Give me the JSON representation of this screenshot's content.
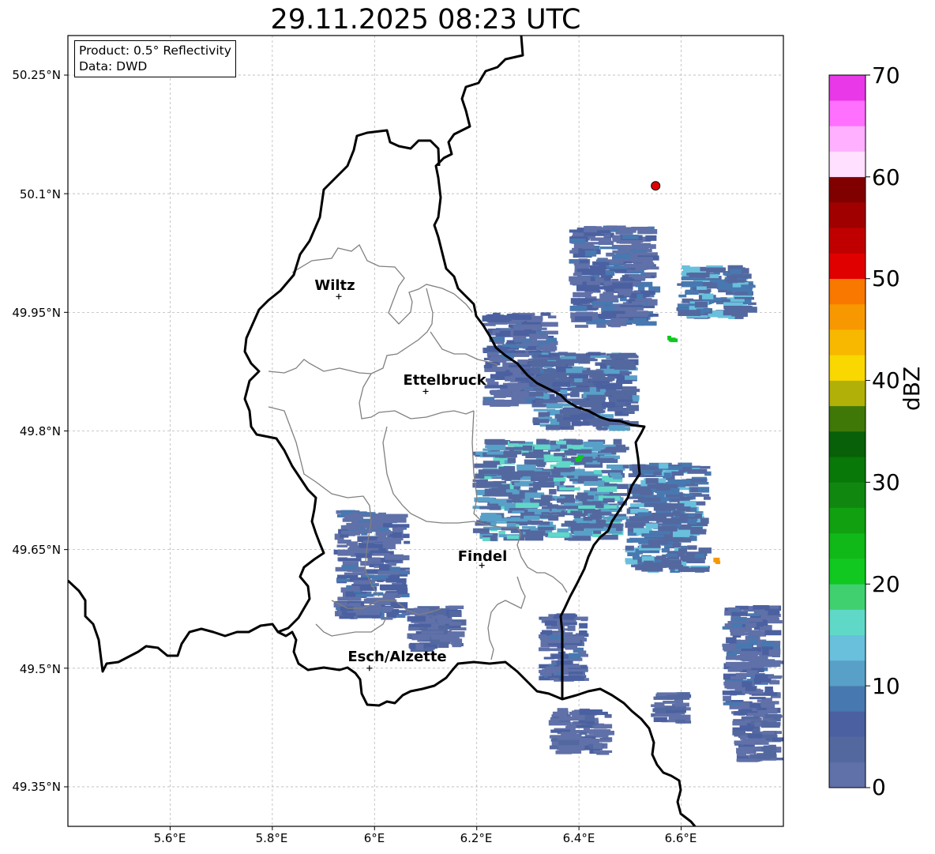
{
  "title": "29.11.2025 08:23 UTC",
  "info_box": {
    "product": "Product: 0.5° Reflectivity",
    "source": "Data: DWD"
  },
  "map": {
    "lon_range": [
      5.4,
      6.8
    ],
    "lat_range": [
      49.3,
      50.3
    ],
    "lat_ticks": [
      {
        "value": 50.25,
        "label": "50.25°N"
      },
      {
        "value": 50.1,
        "label": "50.1°N"
      },
      {
        "value": 49.95,
        "label": "49.95°N"
      },
      {
        "value": 49.8,
        "label": "49.8°N"
      },
      {
        "value": 49.65,
        "label": "49.65°N"
      },
      {
        "value": 49.5,
        "label": "49.5°N"
      },
      {
        "value": 49.35,
        "label": "49.35°N"
      }
    ],
    "lon_ticks": [
      {
        "value": 5.6,
        "label": "5.6°E"
      },
      {
        "value": 5.8,
        "label": "5.8°E"
      },
      {
        "value": 6.0,
        "label": "6°E"
      },
      {
        "value": 6.2,
        "label": "6.2°E"
      },
      {
        "value": 6.4,
        "label": "6.4°E"
      },
      {
        "value": 6.6,
        "label": "6.6°E"
      }
    ],
    "gridlines": true,
    "radar_site": {
      "lon": 6.55,
      "lat": 50.11,
      "color": "#e00000"
    },
    "cities": [
      {
        "name": "Wiltz",
        "lon": 5.93,
        "lat": 49.97
      },
      {
        "name": "Ettelbruck",
        "lon": 6.1,
        "lat": 49.85
      },
      {
        "name": "Findel",
        "lon": 6.21,
        "lat": 49.63
      },
      {
        "name": "Esch/Alzette",
        "lon": 5.99,
        "lat": 49.5
      }
    ]
  },
  "colorbar": {
    "unit": "dBZ",
    "min": 0,
    "max": 70,
    "ticks": [
      "0",
      "10",
      "20",
      "30",
      "40",
      "50",
      "60",
      "70"
    ],
    "colors": [
      "#6070a8",
      "#5468a0",
      "#4a60a0",
      "#4878b0",
      "#58a0c8",
      "#68c0dc",
      "#60d8c8",
      "#40d070",
      "#10c820",
      "#10b818",
      "#10a010",
      "#108810",
      "#087808",
      "#086008",
      "#407808",
      "#b0b008",
      "#f8d800",
      "#f8b800",
      "#f89800",
      "#f87800",
      "#e00000",
      "#c00000",
      "#a00000",
      "#800000",
      "#ffe0ff",
      "#ffb0ff",
      "#ff70ff",
      "#e838e8"
    ]
  },
  "chart_data": {
    "type": "heatmap",
    "title": "29.11.2025 08:23 UTC",
    "x_axis": "longitude",
    "y_axis": "latitude",
    "xlim": [
      5.4,
      6.8
    ],
    "ylim": [
      49.3,
      50.3
    ],
    "value_unit": "dBZ",
    "value_range": [
      0,
      70
    ],
    "summary": "Scattered weak echoes mostly 0-15 dBZ over eastern Luxembourg and western Germany; isolated 20-25 dBZ pixels near 6.4°E 49.76°N and 6.57°E 49.92°N; one ~45 dBZ pixel near 6.66°E 49.63°N.",
    "cells": [
      {
        "lon_min": 6.38,
        "lon_max": 6.56,
        "lat_min": 49.93,
        "lat_max": 50.06,
        "dbz": 6
      },
      {
        "lon_min": 6.59,
        "lon_max": 6.75,
        "lat_min": 49.94,
        "lat_max": 50.01,
        "dbz": 8
      },
      {
        "lon_min": 6.21,
        "lon_max": 6.36,
        "lat_min": 49.83,
        "lat_max": 49.95,
        "dbz": 6
      },
      {
        "lon_min": 6.3,
        "lon_max": 6.52,
        "lat_min": 49.8,
        "lat_max": 49.9,
        "dbz": 7
      },
      {
        "lon_min": 6.19,
        "lon_max": 6.5,
        "lat_min": 49.66,
        "lat_max": 49.79,
        "dbz": 10
      },
      {
        "lon_min": 6.49,
        "lon_max": 6.66,
        "lat_min": 49.62,
        "lat_max": 49.76,
        "dbz": 8
      },
      {
        "lon_min": 5.92,
        "lon_max": 6.07,
        "lat_min": 49.56,
        "lat_max": 49.7,
        "dbz": 5
      },
      {
        "lon_min": 6.06,
        "lon_max": 6.18,
        "lat_min": 49.52,
        "lat_max": 49.58,
        "dbz": 4
      },
      {
        "lon_min": 6.32,
        "lon_max": 6.42,
        "lat_min": 49.48,
        "lat_max": 49.57,
        "dbz": 5
      },
      {
        "lon_min": 6.68,
        "lon_max": 6.8,
        "lat_min": 49.44,
        "lat_max": 49.58,
        "dbz": 5
      },
      {
        "lon_min": 6.54,
        "lon_max": 6.62,
        "lat_min": 49.43,
        "lat_max": 49.47,
        "dbz": 4
      },
      {
        "lon_min": 6.7,
        "lon_max": 6.8,
        "lat_min": 49.38,
        "lat_max": 49.45,
        "dbz": 4
      },
      {
        "lon_min": 6.34,
        "lon_max": 6.47,
        "lat_min": 49.39,
        "lat_max": 49.45,
        "dbz": 4
      },
      {
        "lon_min": 6.57,
        "lon_max": 6.6,
        "lat_min": 49.91,
        "lat_max": 49.93,
        "dbz": 22
      },
      {
        "lon_min": 6.39,
        "lon_max": 6.42,
        "lat_min": 49.76,
        "lat_max": 49.77,
        "dbz": 22
      },
      {
        "lon_min": 6.66,
        "lon_max": 6.68,
        "lat_min": 49.63,
        "lat_max": 49.64,
        "dbz": 45
      }
    ]
  }
}
